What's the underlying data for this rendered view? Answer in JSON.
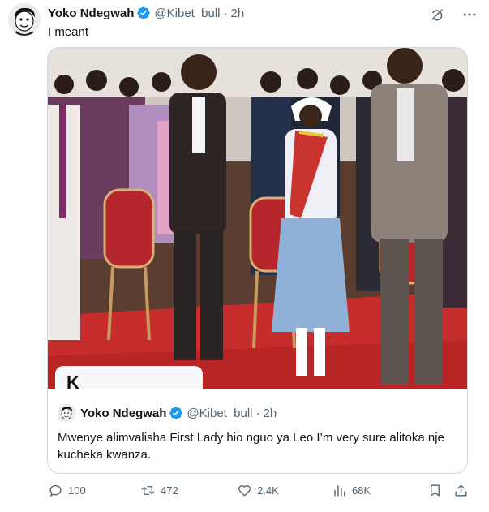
{
  "tweet": {
    "author_name": "Yoko Ndegwah",
    "author_handle": "@Kibet_bull",
    "separator": "·",
    "time": "2h",
    "text": "I meant"
  },
  "quote": {
    "author_name": "Yoko Ndegwah",
    "author_handle": "@Kibet_bull",
    "separator": "·",
    "time": "2h",
    "text": "Mwenye alimvalisha First Lady hio nguo ya Leo I’m very sure alitoka nje kucheka kwanza.",
    "media_overlay_text": "K"
  },
  "actions": {
    "replies": "100",
    "reposts": "472",
    "likes": "2.4K",
    "views": "68K"
  },
  "colors": {
    "verified": "#1d9bf0",
    "secondary_text": "#536471",
    "border": "#cfd9de",
    "carpet": "#c62c2c"
  },
  "icons": [
    "grok-icon",
    "more-icon",
    "reply-icon",
    "repost-icon",
    "like-icon",
    "views-icon",
    "bookmark-icon",
    "share-icon",
    "verified-icon"
  ]
}
